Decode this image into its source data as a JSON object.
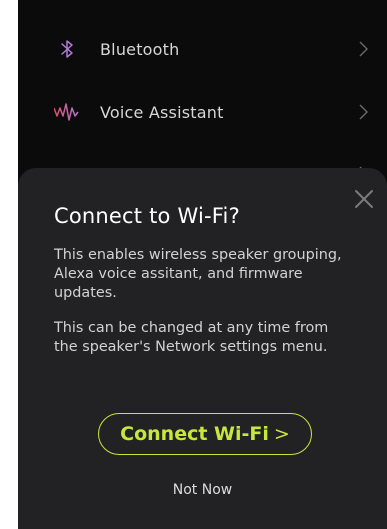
{
  "colors": {
    "screen_bg": "#0b0b0b",
    "sheet_bg": "#222224",
    "accent": "#c8e63c",
    "icon_purple": "#b07cd6",
    "icon_pink": "#e04a6a"
  },
  "settings": {
    "items": [
      {
        "label": "Bluetooth",
        "icon": "bluetooth-icon"
      },
      {
        "label": "Voice Assistant",
        "icon": "voice-waveform-icon"
      }
    ]
  },
  "dialog": {
    "title": "Connect to Wi-Fi?",
    "body1": "This enables wireless speaker grouping, Alexa voice assitant, and firmware updates.",
    "body2": "This can be changed at any time from the speaker's Network settings menu.",
    "primary_label": "Connect Wi-Fi",
    "primary_arrow": ">",
    "secondary_label": "Not Now",
    "close_icon": "close-icon"
  }
}
